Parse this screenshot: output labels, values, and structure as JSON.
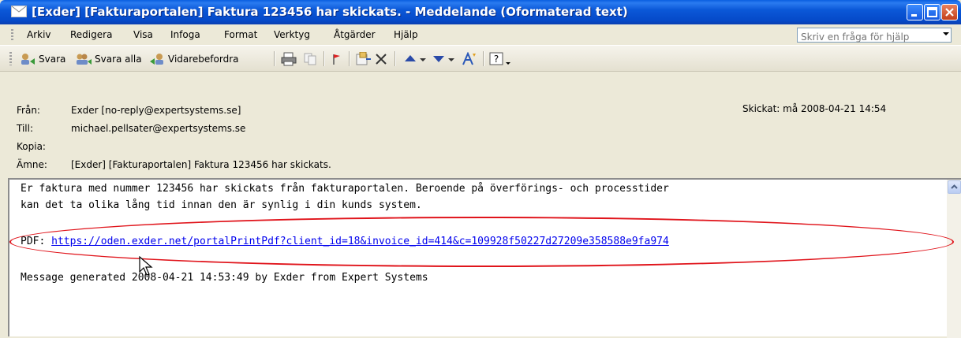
{
  "window": {
    "title": "[Exder] [Fakturaportalen] Faktura 123456 har skickats. - Meddelande (Oformaterad text)"
  },
  "menu": {
    "items": [
      "Arkiv",
      "Redigera",
      "Visa",
      "Infoga",
      "Format",
      "Verktyg",
      "Åtgärder",
      "Hjälp"
    ],
    "help_placeholder": "Skriv en fråga för hjälp"
  },
  "toolbar": {
    "reply": "Svara",
    "reply_all": "Svara alla",
    "forward": "Vidarebefordra"
  },
  "header": {
    "from_label": "Från:",
    "from_value": "Exder [no-reply@expertsystems.se]",
    "to_label": "Till:",
    "to_value": "michael.pellsater@expertsystems.se",
    "cc_label": "Kopia:",
    "cc_value": "",
    "subject_label": "Ämne:",
    "subject_value": "[Exder] [Fakturaportalen] Faktura 123456 har skickats.",
    "sent": "Skickat: må 2008-04-21 14:54"
  },
  "body": {
    "line1": "Er faktura med nummer 123456 har skickats från fakturaportalen. Beroende på överförings- och processtider",
    "line2": "kan det ta olika lång tid innan den är synlig i din kunds system.",
    "pdf_label": "PDF: ",
    "pdf_link": "https://oden.exder.net/portalPrintPdf?client_id=18&invoice_id=414&c=109928f50227d27209e358588e9fa974",
    "footer": "Message generated 2008-04-21 14:53:49 by Exder from Expert Systems"
  },
  "colors": {
    "titlebar": "#0549c8",
    "highlight_oval": "#e0141b",
    "link": "#0000ee"
  }
}
